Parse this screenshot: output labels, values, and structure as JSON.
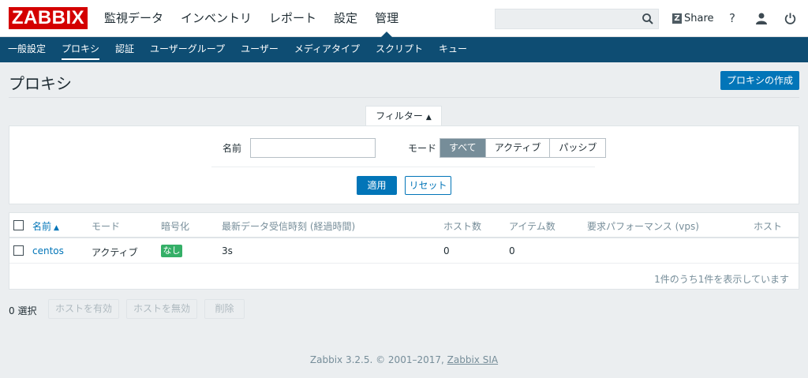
{
  "header": {
    "logo": "ZABBIX",
    "menu": [
      {
        "label": "監視データ",
        "active": false
      },
      {
        "label": "インベントリ",
        "active": false
      },
      {
        "label": "レポート",
        "active": false
      },
      {
        "label": "設定",
        "active": false
      },
      {
        "label": "管理",
        "active": true
      }
    ],
    "search": {
      "value": "",
      "placeholder": ""
    },
    "share_label": "Share",
    "help_glyph": "?",
    "icons": [
      "search-icon",
      "zabbix-share-icon",
      "help-icon",
      "user-icon",
      "power-icon"
    ]
  },
  "subnav": [
    {
      "label": "一般設定",
      "active": false
    },
    {
      "label": "プロキシ",
      "active": true
    },
    {
      "label": "認証",
      "active": false
    },
    {
      "label": "ユーザーグループ",
      "active": false
    },
    {
      "label": "ユーザー",
      "active": false
    },
    {
      "label": "メディアタイプ",
      "active": false
    },
    {
      "label": "スクリプト",
      "active": false
    },
    {
      "label": "キュー",
      "active": false
    }
  ],
  "page": {
    "title": "プロキシ",
    "create_button": "プロキシの作成"
  },
  "filter": {
    "tab_label": "フィルター",
    "name_label": "名前",
    "name_value": "",
    "mode_label": "モード",
    "modes": [
      {
        "label": "すべて",
        "selected": true
      },
      {
        "label": "アクティブ",
        "selected": false
      },
      {
        "label": "パッシブ",
        "selected": false
      }
    ],
    "apply": "適用",
    "reset": "リセット"
  },
  "table": {
    "columns": [
      "名前",
      "モード",
      "暗号化",
      "最新データ受信時刻 (経過時間)",
      "ホスト数",
      "アイテム数",
      "要求パフォーマンス (vps)",
      "ホスト"
    ],
    "sort_column": "名前",
    "rows": [
      {
        "name": "centos",
        "mode": "アクティブ",
        "encryption": "なし",
        "last_seen": "3s",
        "host_count": "0",
        "item_count": "0",
        "perf": "",
        "hosts": ""
      }
    ],
    "footer": "1件のうち1件を表示しています"
  },
  "actions": {
    "selected_count": "0 選択",
    "buttons": [
      "ホストを有効",
      "ホストを無効",
      "削除"
    ]
  },
  "footer": {
    "text": "Zabbix 3.2.5. © 2001–2017,",
    "link": "Zabbix SIA"
  },
  "colors": {
    "brand_red": "#d40000",
    "nav_blue": "#0e4d73",
    "primary_blue": "#0275b8",
    "badge_green": "#34af67",
    "segment_selected": "#768d99"
  }
}
